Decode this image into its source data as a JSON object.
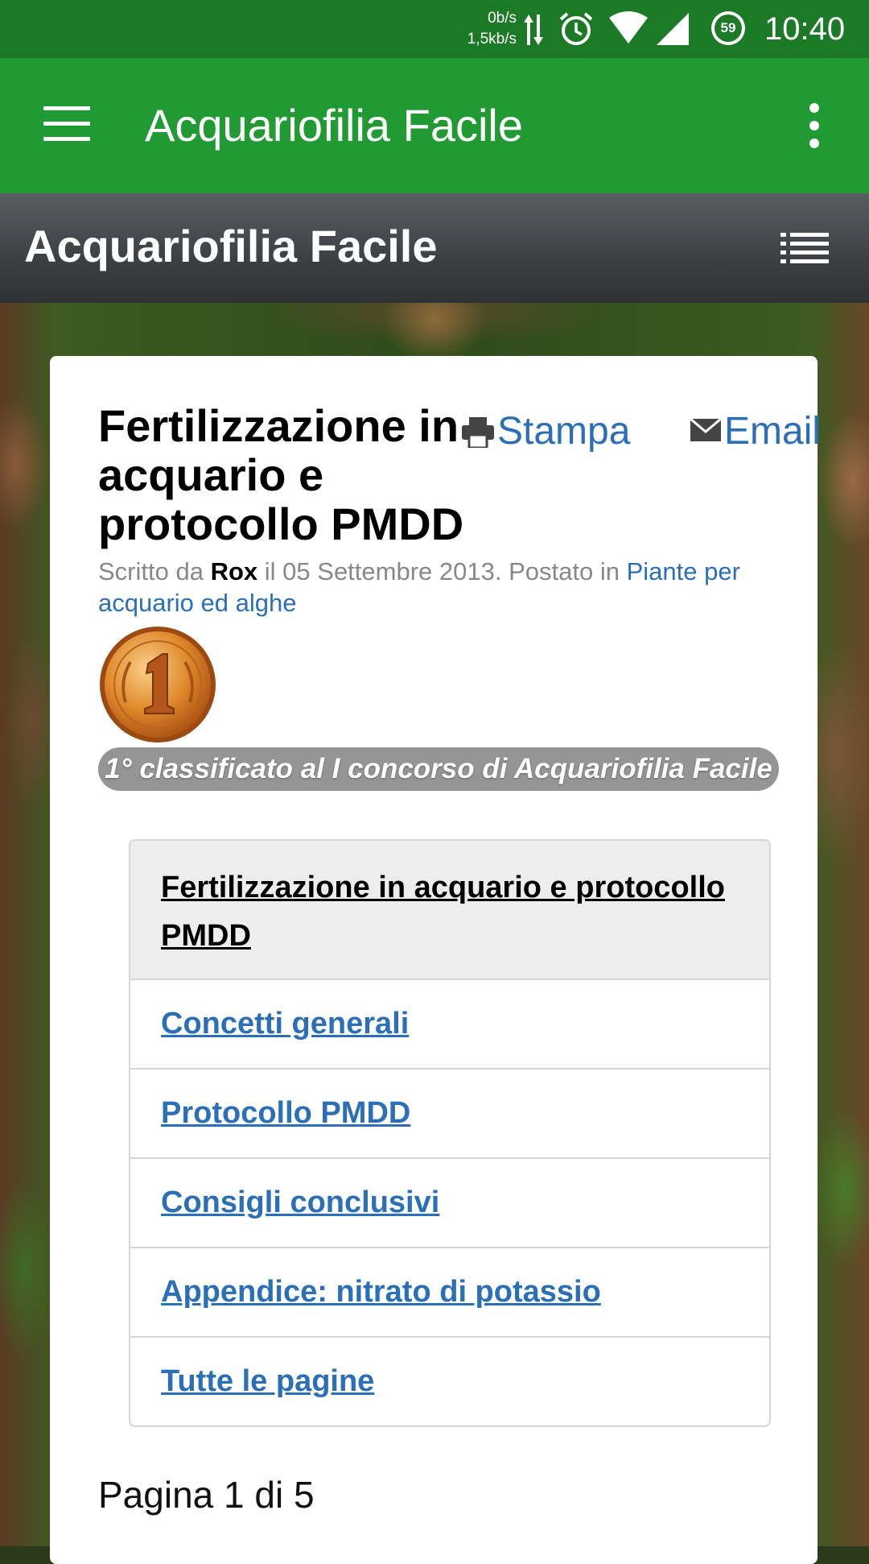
{
  "status_bar": {
    "net_down": "0b/s",
    "net_up": "1,5kb/s",
    "battery": "59",
    "time": "10:40"
  },
  "app_bar": {
    "title": "Acquariofilia Facile",
    "menu_icon": "hamburger-menu-icon",
    "overflow_icon": "more-vert-icon",
    "color": "#219a33"
  },
  "site_header": {
    "title": "Acquariofilia Facile",
    "list_icon": "list-menu-icon"
  },
  "article": {
    "title": "Fertilizzazione in acquario e protocollo PMDD",
    "print_label": "Stampa",
    "email_label": "Email",
    "meta": {
      "written_by": "Scritto da",
      "author": "Rox",
      "date_text": "il 05 Settembre 2013. Postato in",
      "category": "Piante per acquario ed alghe"
    },
    "medal_icon": "gold-medal-icon",
    "award": "1° classificato al I concorso di Acquariofilia Facile",
    "toc": {
      "heading": "Fertilizzazione in acquario e protocollo PMDD",
      "items": [
        "Concetti generali",
        "Protocollo PMDD",
        "Consigli conclusivi",
        "Appendice: nitrato di potassio",
        "Tutte le pagine"
      ]
    },
    "pagination": "Pagina 1 di 5"
  },
  "colors": {
    "link": "#2a6fb8",
    "status_bar": "#1c7a27"
  }
}
